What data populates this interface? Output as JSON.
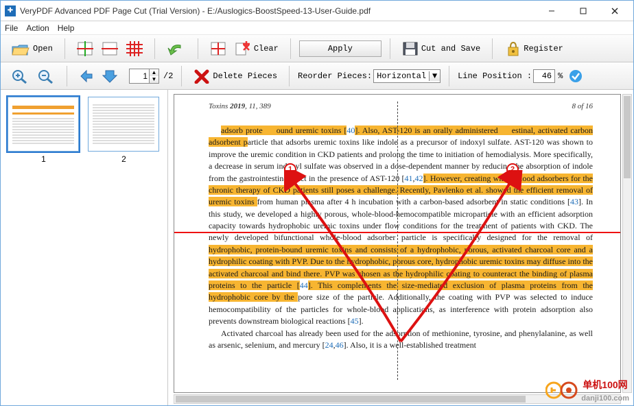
{
  "title": "VeryPDF Advanced PDF Page Cut (Trial Version)  -  E:/Auslogics-BoostSpeed-13-User-Guide.pdf",
  "menu": {
    "file": "File",
    "action": "Action",
    "help": "Help"
  },
  "toolbar": {
    "open": "Open",
    "clear": "Clear",
    "apply": "Apply",
    "cut_save": "Cut and Save",
    "register": "Register"
  },
  "toolbar2": {
    "page_value": "1",
    "page_total": "/2",
    "delete_pieces": "Delete Pieces",
    "reorder_label": "Reorder Pieces:",
    "reorder_value": "Horizontal",
    "line_pos_label": "Line Position :",
    "line_pos_value": "46",
    "percent": "%"
  },
  "thumbs": {
    "t1": "1",
    "t2": "2"
  },
  "doc": {
    "header_left": "Toxins 2019, 11, 389",
    "header_right": "8 of 16",
    "p1a": "adsorb prote",
    "p1b": "ound uremic toxins [",
    "ref40": "40",
    "p1c": "]. Also, AST-120 is an orally administered",
    "p1d": "estinal, activated carbon adsorbent p",
    "p1e": "article that adsorbs uremic toxins like indole as a precursor of indoxyl sulfate. AST-120 was shown to improve the uremic condition in CKD patients and prolong the time to initiation of hemodialysis. More specifically, a decrease in serum indoxyl sulfate was observed in a dose-dependent manner by reducing the absorption of indole from the gastrointestinal tract in the presence of AST-120 [",
    "ref41": "41",
    "comma": ",",
    "ref42": "42",
    "p1f": "]. However, creating whole-blood adsorbers for the chronic therapy of CKD patients still poses a challenge. Recently, Pavlenko et al. showed the efficient removal of uremic toxins ",
    "p1g": "from human plasma after 4 h incubation with a carbon-based adsorbent in static conditions [",
    "ref43": "43",
    "p1h": "]. In this study, we developed a highly porous, whole-blood-hemocompatible microparticle with an efficient adsorption capacity towards hydrophobic uremic toxins under flow conditions for the treatment of patients with CKD. The newly developed bifunctional whole-blood adsorber particle is specifically designed for the removal of ",
    "hl2a": "hydrophobic, protein-bound uremic toxins and consists of a hydrophobic, porous, activated charcoal core and a hydrophilic coating with PVP. Due to the hydrophobic, porous core, hydrophobic uremic toxins may diffuse into the activated charcoal and bind there. PVP was chosen as the hydrophilic coating to counteract the binding of plasma proteins to the particle [",
    "ref44": "44",
    "hl2b": "]. This complements the size-mediated exclusion of plasma proteins from the hydrophobic core by the ",
    "p1i": "pore size of the particle. Additionally, the coating with PVP was selected to induce hemocompatibility of the particles for whole-blood applications, as interference with protein adsorption also prevents downstream biological reactions [",
    "ref45": "45",
    "p1j": "].",
    "p2a": "Activated charcoal has already been used for the adsorption of methionine, tyrosine, and phenylalanine, as well as arsenic, selenium, and mercury [",
    "ref24": "24",
    "ref46": "46",
    "p2b": "]. Also, it is a well-established treatment"
  },
  "badges": {
    "b1": "1",
    "b2": "2"
  },
  "watermark": {
    "text": "单机100网",
    "url": "danji100.com"
  }
}
